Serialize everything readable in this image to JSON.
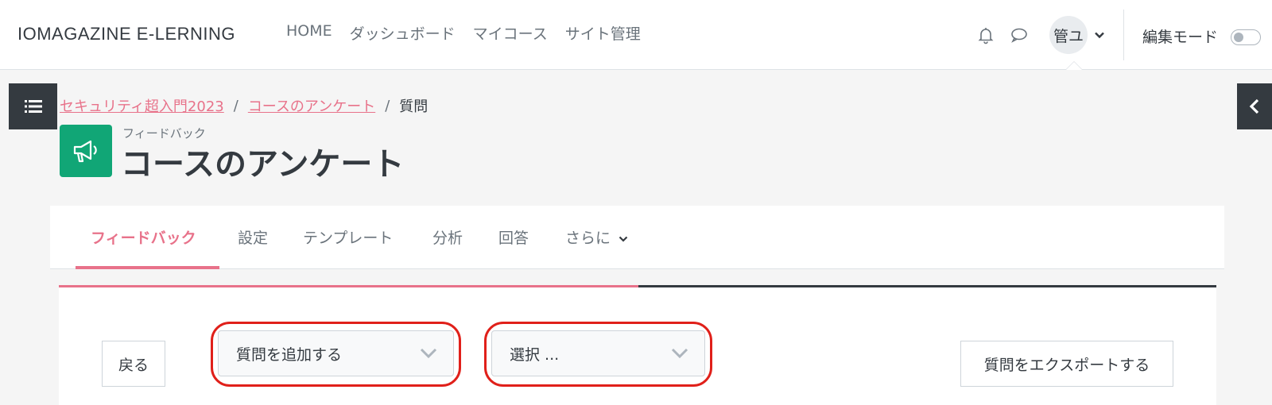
{
  "navbar": {
    "brand": "IOMAGAZINE E-LERNING",
    "items": [
      "HOME",
      "ダッシュボード",
      "マイコース",
      "サイト管理"
    ],
    "user_initials": "管ユ",
    "edit_mode_label": "編集モード",
    "edit_mode_on": false
  },
  "breadcrumb": {
    "items": [
      "セキュリティ超入門2023",
      "コースのアンケート",
      "質問"
    ]
  },
  "page_header": {
    "module_type": "フィードバック",
    "title": "コースのアンケート",
    "icon_color": "#11a676"
  },
  "secondary_nav": {
    "tabs": [
      "フィードバック",
      "設定",
      "テンプレート",
      "分析",
      "回答",
      "さらに"
    ],
    "active_index": 0
  },
  "actions": {
    "back_label": "戻る",
    "add_question_select": "質問を追加する",
    "choose_select": "選択 ...",
    "export_label": "質問をエクスポートする"
  },
  "colors": {
    "accent": "#e8728a",
    "dark": "#343a40",
    "highlight": "#e0201a"
  }
}
